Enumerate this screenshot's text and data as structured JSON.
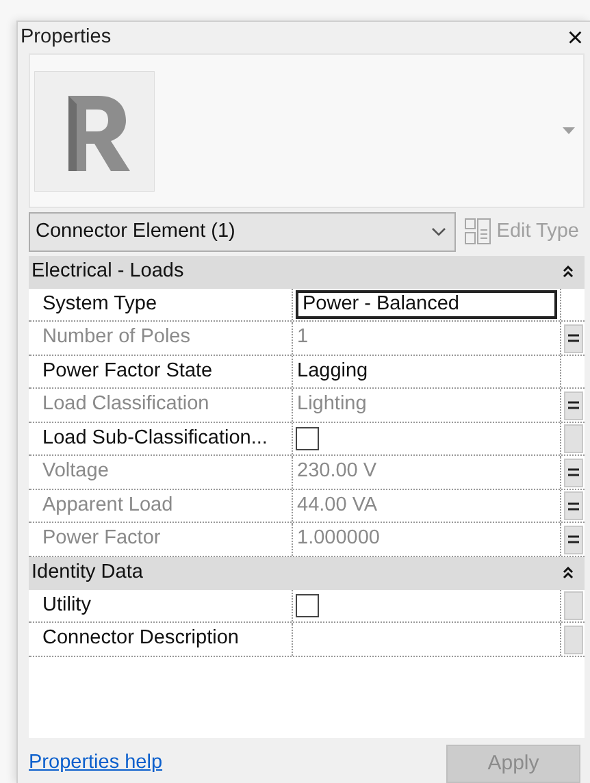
{
  "window": {
    "title": "Properties",
    "close": "×"
  },
  "type_selector": {
    "value": "Connector Element (1)",
    "edit_type": "Edit Type",
    "edit_type_disabled": true
  },
  "groups": [
    {
      "title": "Electrical - Loads",
      "expanded": true,
      "rows": [
        {
          "label": "System Type",
          "kind": "text",
          "value": "Power - Balanced",
          "disabled": false,
          "selected": true
        },
        {
          "label": "Number of Poles",
          "kind": "text",
          "value": "1",
          "disabled": true,
          "selected": false,
          "button": {
            "kind": "associate"
          }
        },
        {
          "label": "Power Factor State",
          "kind": "text",
          "value": "Lagging",
          "disabled": false,
          "selected": false
        },
        {
          "label": "Load Classification",
          "kind": "text",
          "value": "Lighting",
          "disabled": true,
          "selected": false,
          "button": {
            "kind": "associate"
          }
        },
        {
          "label": "Load Sub-Classification...",
          "kind": "checkbox",
          "checked": false,
          "disabled": false,
          "selected": false,
          "button": {
            "kind": "plain"
          }
        },
        {
          "label": "Voltage",
          "kind": "text",
          "value": "230.00 V",
          "disabled": true,
          "selected": false,
          "button": {
            "kind": "associate"
          }
        },
        {
          "label": "Apparent Load",
          "kind": "text",
          "value": "44.00 VA",
          "disabled": true,
          "selected": false,
          "button": {
            "kind": "associate"
          }
        },
        {
          "label": "Power Factor",
          "kind": "text",
          "value": "1.000000",
          "disabled": true,
          "selected": false,
          "button": {
            "kind": "associate"
          }
        }
      ]
    },
    {
      "title": "Identity Data",
      "expanded": true,
      "rows": [
        {
          "label": "Utility",
          "kind": "checkbox",
          "checked": false,
          "disabled": false,
          "selected": false,
          "button": {
            "kind": "plain"
          }
        },
        {
          "label": "Connector Description",
          "kind": "text",
          "disabled": false,
          "selected": false,
          "button": {
            "kind": "plain"
          }
        }
      ]
    }
  ],
  "footer": {
    "help_link": "Properties help",
    "apply": "Apply",
    "apply_disabled": true
  }
}
